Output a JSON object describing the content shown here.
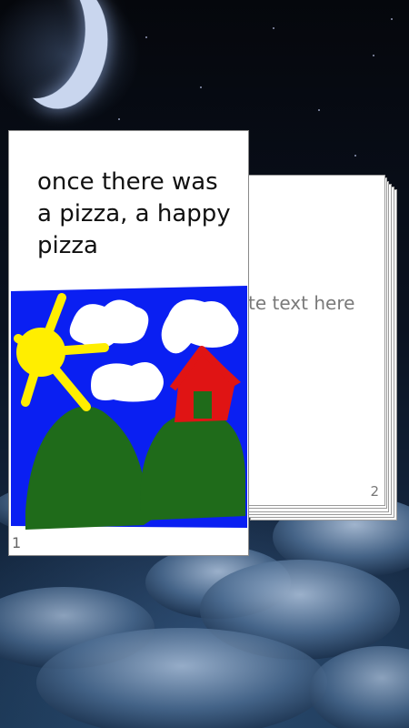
{
  "background": {
    "scene": "night-sky",
    "moon_icon": "crescent-moon-icon",
    "colors": {
      "sky_top": "#05070c",
      "sky_bottom": "#1e3b5a"
    }
  },
  "pages": [
    {
      "number": "1",
      "text": "once there was a pizza, a happy pizza",
      "drawing": {
        "elements": [
          "sun",
          "clouds",
          "house",
          "hills"
        ],
        "colors": {
          "sky": "#0a1ff2",
          "sun": "#ffee00",
          "hill": "#1f6b1a",
          "house": "#e01414",
          "door": "#1f6b1a",
          "cloud": "#ffffff"
        }
      }
    },
    {
      "number": "2",
      "placeholder": "te text here"
    }
  ]
}
